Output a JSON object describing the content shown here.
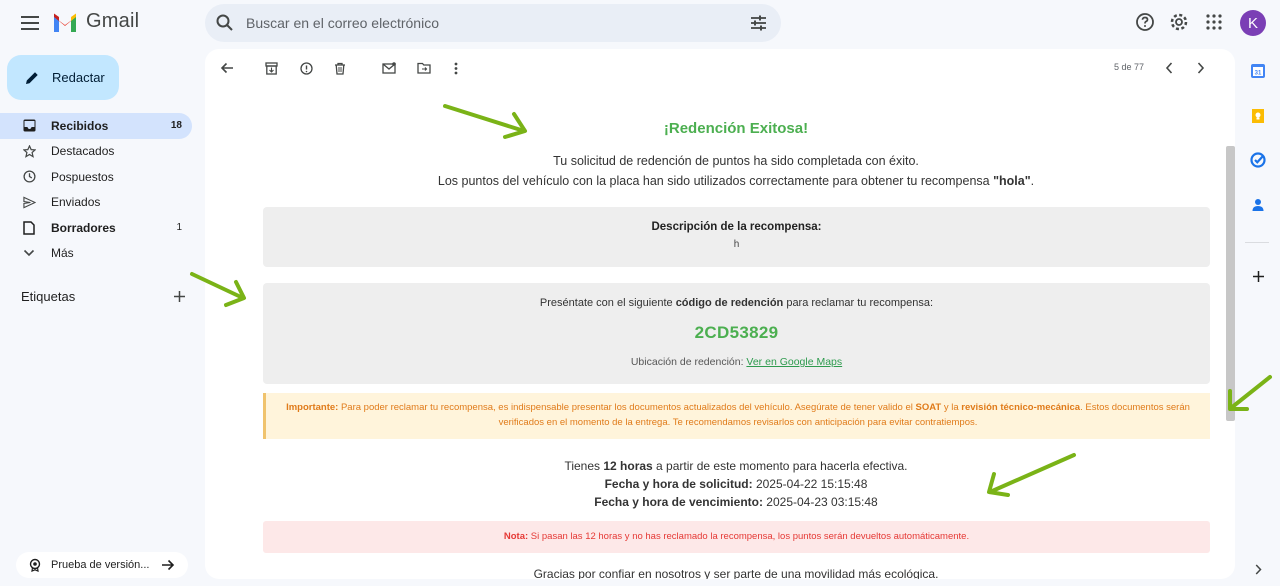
{
  "app": {
    "name": "Gmail"
  },
  "search": {
    "placeholder": "Buscar en el correo electrónico"
  },
  "account": {
    "initial": "K",
    "color": "#7b3fb5"
  },
  "compose": {
    "label": "Redactar"
  },
  "sidebar": {
    "items": [
      {
        "label": "Recibidos",
        "count": "18",
        "active": true,
        "icon": "inbox-icon"
      },
      {
        "label": "Destacados",
        "count": "",
        "icon": "star-icon"
      },
      {
        "label": "Pospuestos",
        "count": "",
        "icon": "clock-icon"
      },
      {
        "label": "Enviados",
        "count": "",
        "icon": "send-icon"
      },
      {
        "label": "Borradores",
        "count": "1",
        "icon": "draft-icon"
      },
      {
        "label": "Más",
        "count": "",
        "icon": "chevron-down-icon"
      }
    ],
    "labels_title": "Etiquetas",
    "promo_label": "Prueba de versión..."
  },
  "toolbar": {
    "pager": "5 de 77"
  },
  "email": {
    "title": "¡Redención Exitosa!",
    "intro_line1": "Tu solicitud de redención de puntos ha sido completada con éxito.",
    "intro_line2_prefix": "Los puntos del vehículo con la placa han sido utilizados correctamente para obtener tu recompensa ",
    "reward_name": "\"hola\"",
    "intro_line2_suffix": ".",
    "description_title": "Descripción de la recompensa:",
    "description_text": "h",
    "code_intro_prefix": "Preséntate con el siguiente ",
    "code_intro_bold": "código de redención",
    "code_intro_suffix": " para reclamar tu recompensa:",
    "code": "2CD53829",
    "location_label": "Ubicación de redención: ",
    "location_link": "Ver en Google Maps",
    "warning_bold": "Importante:",
    "warning_text1": " Para poder reclamar tu recompensa, es indispensable presentar los documentos actualizados del vehículo. Asegúrate de tener valido el ",
    "warning_soat": "SOAT",
    "warning_text2": " y la ",
    "warning_rtm": "revisión técnico-mecánica",
    "warning_text3": ". Estos documentos serán verificados en el momento de la entrega. Te recomendamos revisarlos con anticipación para evitar contratiempos.",
    "time_prefix": "Tienes ",
    "time_bold": "12 horas",
    "time_suffix": " a partir de este momento para hacerla efectiva.",
    "request_label": "Fecha y hora de solicitud:",
    "request_value": " 2025-04-22 15:15:48",
    "expiry_label": "Fecha y hora de vencimiento:",
    "expiry_value": " 2025-04-23 03:15:48",
    "note_bold": "Nota:",
    "note_text": " Si pasan las 12 horas y no has reclamado la recompensa, los puntos serán devueltos automáticamente.",
    "thanks": "Gracias por confiar en nosotros y ser parte de una movilidad más ecológica."
  },
  "colors": {
    "accent_green": "#4caf50",
    "warning_orange": "#e07b1a",
    "note_red": "#e53935",
    "arrow_green": "#7ab317"
  }
}
